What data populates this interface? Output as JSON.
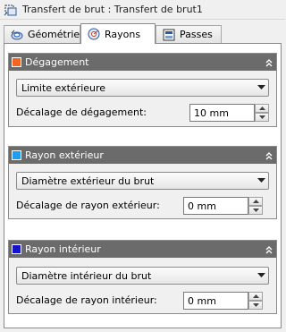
{
  "window": {
    "title": "Transfert de brut : Transfert de brut1"
  },
  "tabs": [
    {
      "label": "Géométrie",
      "active": false
    },
    {
      "label": "Rayons",
      "active": true
    },
    {
      "label": "Passes",
      "active": false
    }
  ],
  "panels": {
    "clearance": {
      "title": "Dégagement",
      "color": "#f26522",
      "dropdown_value": "Limite extérieure",
      "field_label": "Décalage de dégagement:",
      "field_value": "10 mm"
    },
    "outer": {
      "title": "Rayon extérieur",
      "color": "#1e9ef0",
      "dropdown_value": "Diamètre extérieur du brut",
      "field_label": "Décalage de rayon extérieur:",
      "field_value": "0 mm"
    },
    "inner": {
      "title": "Rayon intérieur",
      "color": "#1414c8",
      "dropdown_value": "Diamètre intérieur du brut",
      "field_label": "Décalage de rayon intérieur:",
      "field_value": "0 mm"
    }
  },
  "icons": {
    "title": "stock-transfer-icon",
    "tab_geometry": "geometry-icon",
    "tab_radii": "radii-icon",
    "tab_passes": "passes-icon",
    "collapse": "double-chevron-up-icon",
    "dropdown": "chevron-down-icon",
    "spin_up": "spin-up-icon",
    "spin_down": "spin-down-icon"
  }
}
